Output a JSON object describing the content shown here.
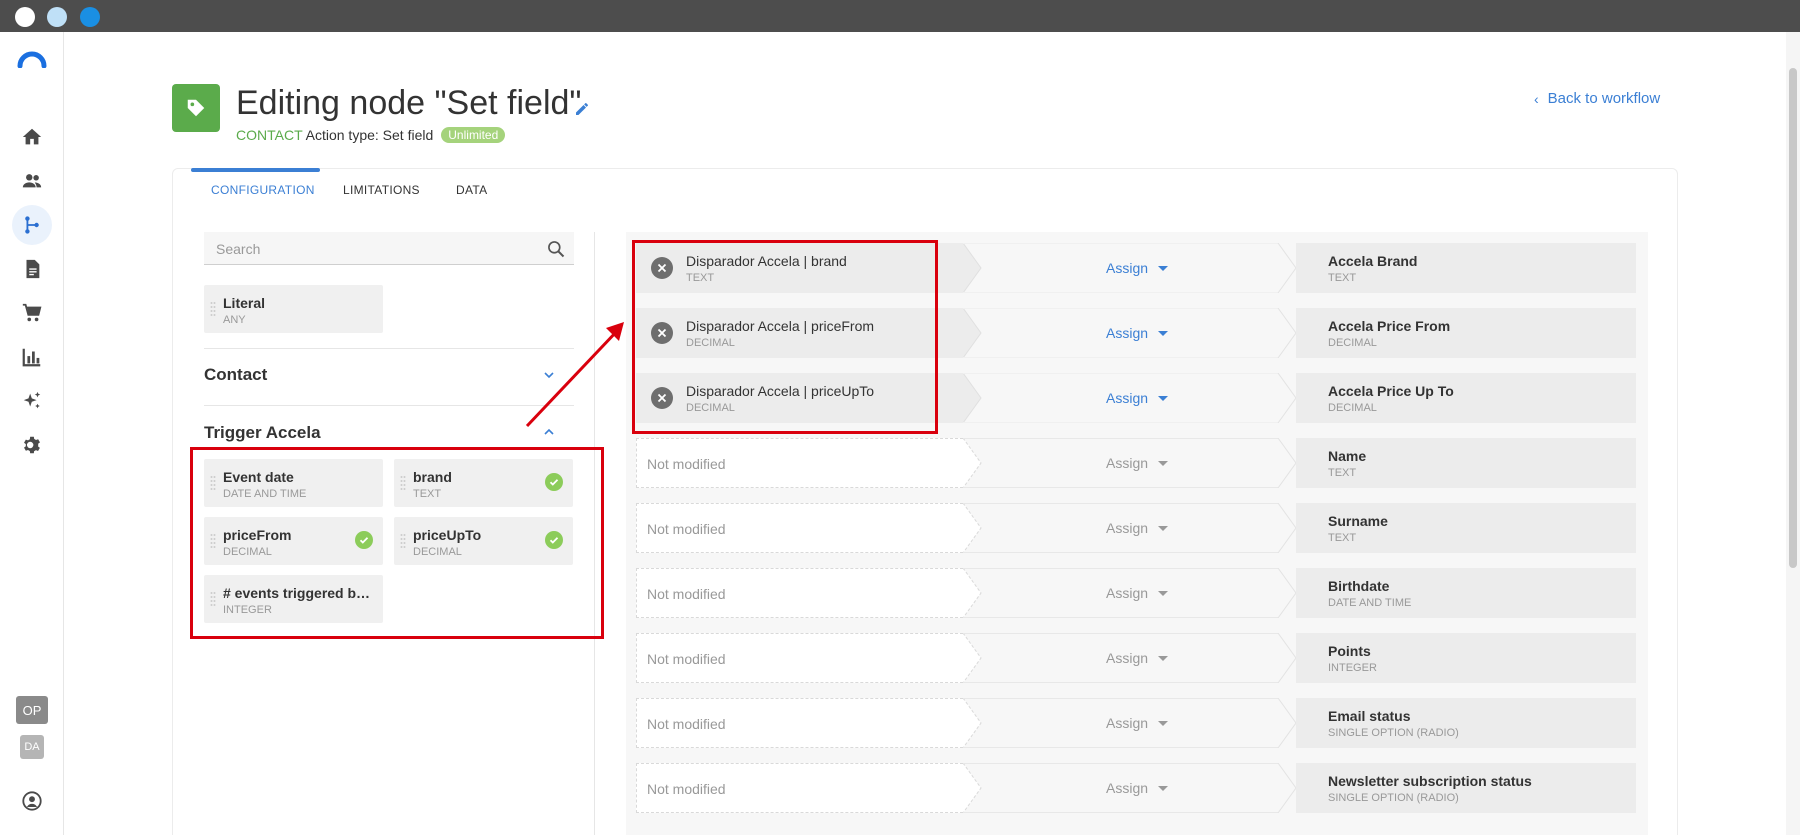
{
  "window": {
    "dots": [
      "#ffffff",
      "#bfe0f7",
      "#1a8fe3"
    ]
  },
  "nav": {
    "items": [
      "home-icon",
      "people-icon",
      "workflow-icon",
      "document-icon",
      "cart-icon",
      "chart-icon",
      "sparkle-icon",
      "gear-icon"
    ],
    "active": "workflow-icon",
    "workspace_badges": [
      "OP",
      "DA"
    ]
  },
  "header": {
    "title": "Editing node \"Set field\"",
    "entity": "CONTACT",
    "action_type": "Action type: Set field",
    "pill": "Unlimited",
    "back_link": "Back to workflow"
  },
  "tabs": [
    {
      "label": "CONFIGURATION",
      "active": true
    },
    {
      "label": "LIMITATIONS",
      "active": false
    },
    {
      "label": "DATA",
      "active": false
    }
  ],
  "search": {
    "placeholder": "Search"
  },
  "literal": {
    "name": "Literal",
    "type": "ANY"
  },
  "sections": {
    "contact": {
      "label": "Contact",
      "expanded": false
    },
    "trigger": {
      "label": "Trigger Accela",
      "expanded": true
    }
  },
  "trigger_fields": [
    {
      "name": "Event date",
      "type": "DATE AND TIME",
      "used": false
    },
    {
      "name": "brand",
      "type": "TEXT",
      "used": true
    },
    {
      "name": "priceFrom",
      "type": "DECIMAL",
      "used": true
    },
    {
      "name": "priceUpTo",
      "type": "DECIMAL",
      "used": true
    },
    {
      "name": "# events triggered by t...",
      "type": "INTEGER",
      "used": false
    }
  ],
  "mappings": [
    {
      "source": "Disparador Accela | brand",
      "source_type": "TEXT",
      "action": "Assign",
      "target": "Accela Brand",
      "target_type": "TEXT"
    },
    {
      "source": "Disparador Accela | priceFrom",
      "source_type": "DECIMAL",
      "action": "Assign",
      "target": "Accela Price From",
      "target_type": "DECIMAL"
    },
    {
      "source": "Disparador Accela | priceUpTo",
      "source_type": "DECIMAL",
      "action": "Assign",
      "target": "Accela Price Up To",
      "target_type": "DECIMAL"
    },
    {
      "source": "Not modified",
      "source_type": "",
      "action": "Assign",
      "target": "Name",
      "target_type": "TEXT"
    },
    {
      "source": "Not modified",
      "source_type": "",
      "action": "Assign",
      "target": "Surname",
      "target_type": "TEXT"
    },
    {
      "source": "Not modified",
      "source_type": "",
      "action": "Assign",
      "target": "Birthdate",
      "target_type": "DATE AND TIME"
    },
    {
      "source": "Not modified",
      "source_type": "",
      "action": "Assign",
      "target": "Points",
      "target_type": "INTEGER"
    },
    {
      "source": "Not modified",
      "source_type": "",
      "action": "Assign",
      "target": "Email status",
      "target_type": "SINGLE OPTION (RADIO)"
    },
    {
      "source": "Not modified",
      "source_type": "",
      "action": "Assign",
      "target": "Newsletter subscription status",
      "target_type": "SINGLE OPTION (RADIO)"
    }
  ],
  "colors": {
    "accent": "#3b7fd4",
    "node": "#5bab4b",
    "success": "#8ccc5a",
    "annotation": "#d9000d"
  }
}
